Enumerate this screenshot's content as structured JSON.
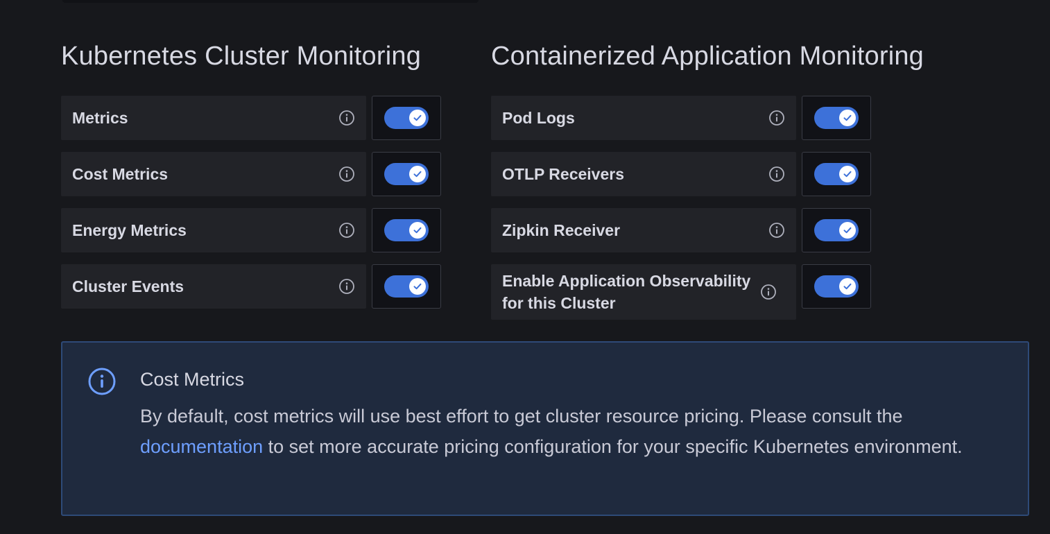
{
  "colors": {
    "background": "#17181c",
    "row_background": "#222328",
    "toggle_on": "#3d71d9",
    "alert_background": "#1f2a3e",
    "alert_border": "#2e4a78",
    "link": "#6e9fff",
    "info_icon_alert": "#6e9fff"
  },
  "left": {
    "title": "Kubernetes Cluster Monitoring",
    "items": [
      {
        "label": "Metrics",
        "enabled": true,
        "icon": "info-circle-icon"
      },
      {
        "label": "Cost Metrics",
        "enabled": true,
        "icon": "info-circle-icon"
      },
      {
        "label": "Energy Metrics",
        "enabled": true,
        "icon": "info-circle-icon"
      },
      {
        "label": "Cluster Events",
        "enabled": true,
        "icon": "info-circle-icon"
      }
    ]
  },
  "right": {
    "title": "Containerized Application Monitoring",
    "items": [
      {
        "label": "Pod Logs",
        "enabled": true,
        "icon": "info-circle-icon"
      },
      {
        "label": "OTLP Receivers",
        "enabled": true,
        "icon": "info-circle-icon"
      },
      {
        "label": "Zipkin Receiver",
        "enabled": true,
        "icon": "info-circle-icon"
      },
      {
        "label": "Enable Application Observability for this Cluster",
        "enabled": true,
        "icon": "info-circle-icon"
      }
    ]
  },
  "alert": {
    "icon": "info-circle-icon",
    "title": "Cost Metrics",
    "body_before_link": "By default, cost metrics will use best effort to get cluster resource pricing. Please consult the ",
    "link_text": "documentation",
    "body_after_link": " to set more accurate pricing configuration for your specific Kubernetes environment."
  }
}
